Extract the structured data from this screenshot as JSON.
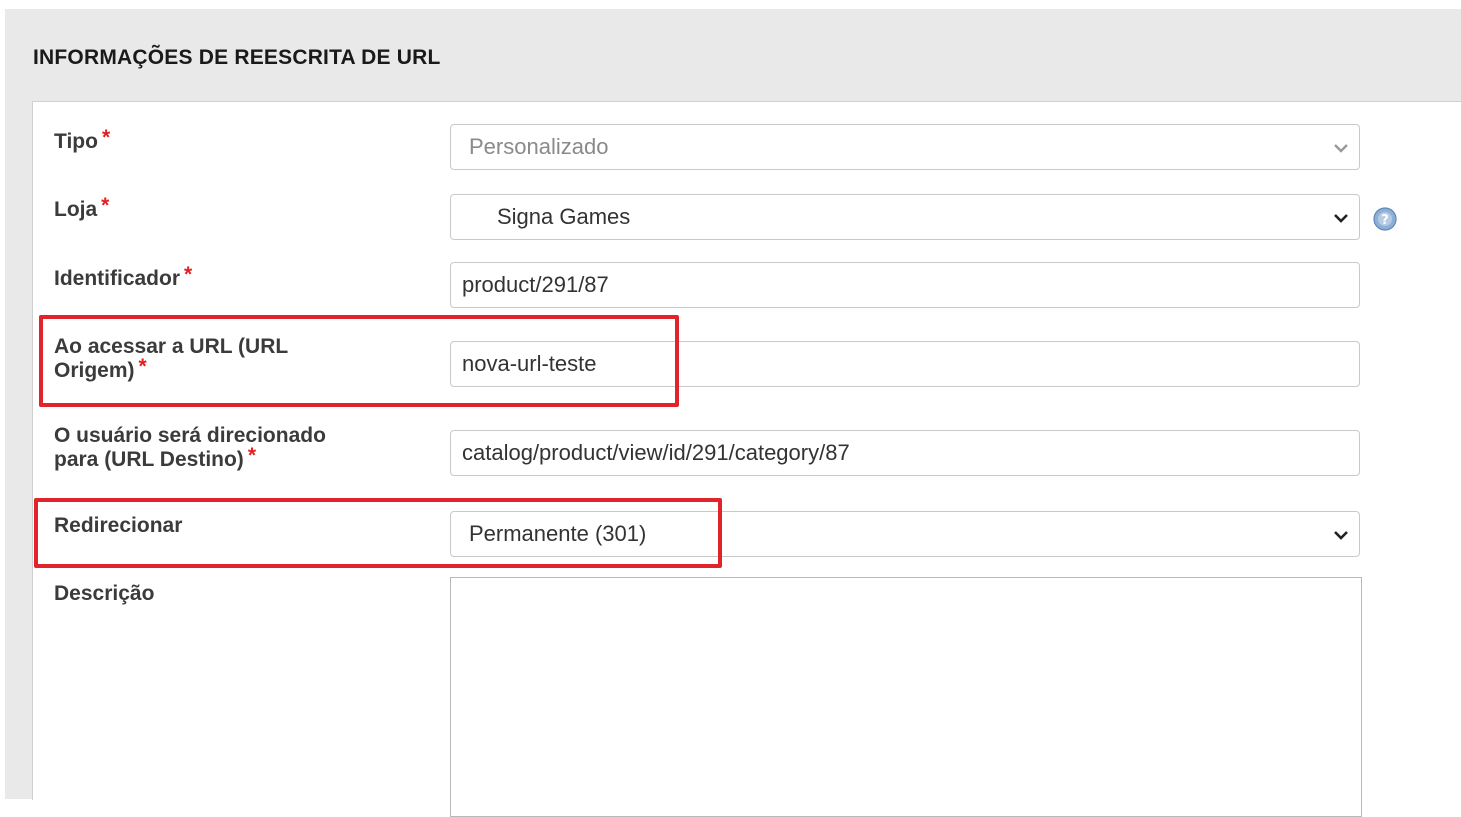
{
  "section": {
    "title": "INFORMAÇÕES DE REESCRITA DE URL"
  },
  "form": {
    "tipo": {
      "label": "Tipo",
      "required": "*",
      "value": "Personalizado"
    },
    "loja": {
      "label": "Loja",
      "required": "*",
      "value": "Signa Games"
    },
    "identificador": {
      "label": "Identificador",
      "required": "*",
      "value": "product/291/87"
    },
    "url_origem": {
      "label_line1": "Ao acessar a URL (URL",
      "label_line2": "Origem)",
      "required": "*",
      "value": "nova-url-teste"
    },
    "url_destino": {
      "label_line1": "O usuário será direcionado",
      "label_line2": "para (URL Destino)",
      "required": "*",
      "value": "catalog/product/view/id/291/category/87"
    },
    "redirecionar": {
      "label": "Redirecionar",
      "value": "Permanente (301)"
    },
    "descricao": {
      "label": "Descrição",
      "value": ""
    }
  },
  "icons": {
    "dropdown": "chevron-down-icon",
    "help": "help-icon"
  },
  "colors": {
    "highlight": "#e0242a",
    "required": "#e41f1f",
    "panel": "#e9e9e9"
  }
}
